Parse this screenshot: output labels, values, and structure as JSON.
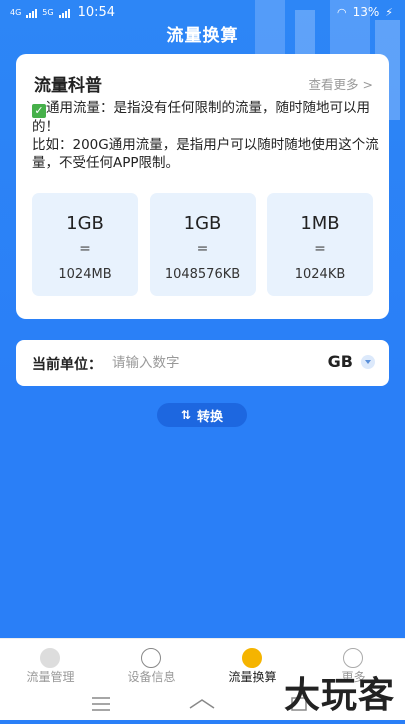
{
  "status": {
    "time": "10:54",
    "battery": "13%",
    "net1": "4G",
    "net2": "5G"
  },
  "header": {
    "title": "流量换算"
  },
  "card": {
    "title": "流量科普",
    "more": "查看更多 >",
    "line1": "通用流量：是指没有任何限制的流量，随时随地可以用的！",
    "line2": "比如：200G通用流量，是指用户可以随时随地使用这个流量，不受任何APP限制。",
    "units": [
      {
        "top": "1GB",
        "eq": "=",
        "bottom": "1024MB"
      },
      {
        "top": "1GB",
        "eq": "=",
        "bottom": "1048576KB"
      },
      {
        "top": "1MB",
        "eq": "=",
        "bottom": "1024KB"
      }
    ]
  },
  "converter": {
    "label": "当前单位：",
    "placeholder": "请输入数字",
    "unit": "GB",
    "button": "转换"
  },
  "tabs": [
    {
      "label": "流量管理"
    },
    {
      "label": "设备信息"
    },
    {
      "label": "流量换算"
    },
    {
      "label": "更多"
    }
  ],
  "watermark": "大玩客",
  "colors": {
    "primary": "#2a7ff7",
    "button": "#1d67e0",
    "active_tab": "#f5b400"
  }
}
